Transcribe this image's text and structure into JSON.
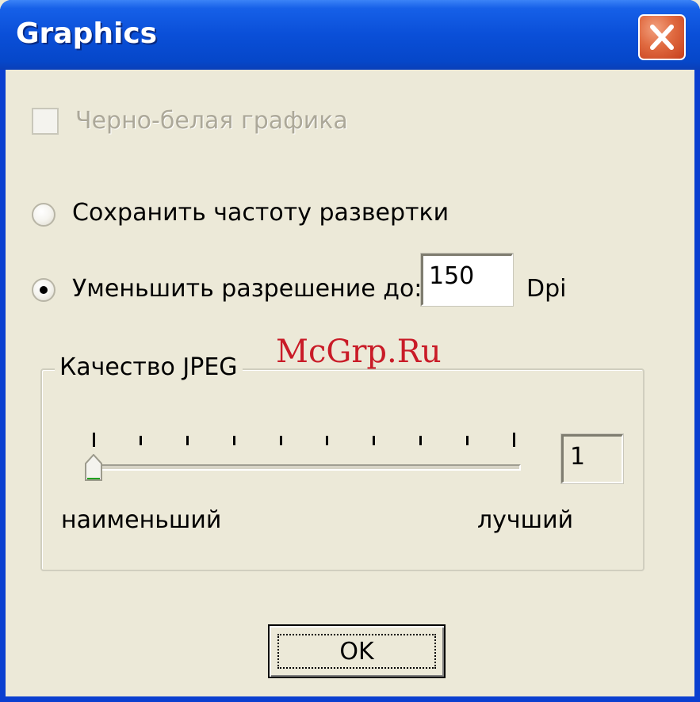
{
  "window": {
    "title": "Graphics"
  },
  "options": {
    "bw_label": "Черно-белая графика",
    "keep_freq_label": "Сохранить частоту развертки",
    "reduce_label": "Уменьшить разрешение до:",
    "dpi_value": "150",
    "dpi_unit": "Dpi"
  },
  "jpeg": {
    "group_label": "Качество JPEG",
    "min_label": "наименьший",
    "max_label": "лучший",
    "value": "1",
    "slider_level": 0
  },
  "buttons": {
    "ok": "OK"
  },
  "watermark": "McGrp.Ru",
  "colors": {
    "title_blue": "#0A4FD8",
    "close_red": "#E06A40",
    "face": "#ECE9D8",
    "watermark": "#C8101E"
  }
}
